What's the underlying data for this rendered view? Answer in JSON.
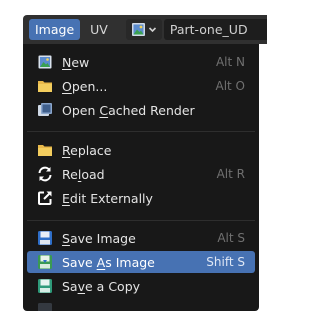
{
  "header": {
    "menus": [
      "Image",
      "UV"
    ],
    "image_name": "Part-one_UD"
  },
  "menu": {
    "items": [
      {
        "pre": "",
        "ul": "N",
        "post": "ew",
        "shortcut": "Alt N",
        "icon": "new-image-icon"
      },
      {
        "pre": "",
        "ul": "O",
        "post": "pen...",
        "shortcut": "Alt O",
        "icon": "folder-icon"
      },
      {
        "pre": "Open ",
        "ul": "C",
        "post": "ached Render",
        "shortcut": "",
        "icon": "render-result-icon"
      },
      {
        "pre": "",
        "ul": "R",
        "post": "eplace",
        "shortcut": "",
        "icon": "folder-icon"
      },
      {
        "pre": "Re",
        "ul": "l",
        "post": "oad",
        "shortcut": "Alt R",
        "icon": "reload-icon"
      },
      {
        "pre": "",
        "ul": "E",
        "post": "dit Externally",
        "shortcut": "",
        "icon": "external-edit-icon"
      },
      {
        "pre": "",
        "ul": "S",
        "post": "ave Image",
        "shortcut": "Alt S",
        "icon": "save-icon"
      },
      {
        "pre": "Save ",
        "ul": "A",
        "post": "s Image",
        "shortcut": "Shift S",
        "icon": "save-as-icon"
      },
      {
        "pre": "Sa",
        "ul": "v",
        "post": "e a Copy",
        "shortcut": "",
        "icon": "save-copy-icon"
      }
    ]
  },
  "colors": {
    "accent": "#4772b3",
    "menu_bg": "#181818",
    "header_bg": "#303030"
  }
}
